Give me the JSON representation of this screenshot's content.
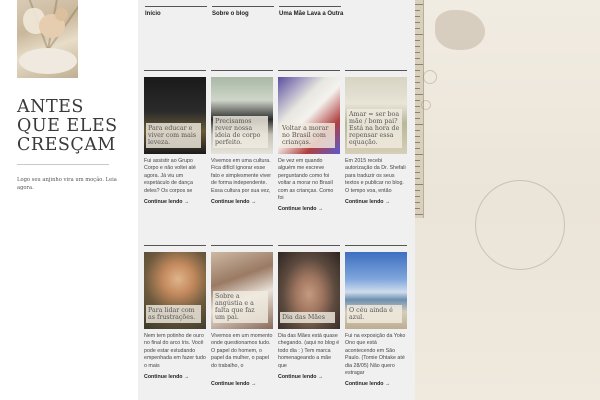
{
  "site": {
    "title": "ANTES QUE ELES CRESÇAM",
    "description": "Logo seu anjinho vira um moção. Leia agora."
  },
  "nav": {
    "items": [
      "Início",
      "Sobre o blog",
      "Uma Mãe Lava a Outra"
    ]
  },
  "posts": [
    {
      "caption": "Para educar e viver com mais leveza.",
      "excerpt": "Fui assistir ao Grupo Corpo e não voltei até agora. Já viu um espetáculo de dança deles? Os corpos se",
      "more": "Continue lendo →"
    },
    {
      "caption": "Precisamos rever nossa ideia de corpo perfeito.",
      "excerpt": "Vivemos em uma cultura. Fica difícil ignorar esse fato e simplesmente viver de forma independente. Essa cultura por sua vez,",
      "more": "Continue lendo →"
    },
    {
      "caption": "Voltar a morar no Brasil com crianças.",
      "excerpt": "De vez em quando alguém me escreve perguntando como foi voltar a morar no Brasil com as crianças. Como foi",
      "more": "Continue lendo →"
    },
    {
      "caption": "Amar = ser boa mãe / bom pai? Está na hora de repensar essa equação.",
      "excerpt": "Em 2015 recebi autorização da Dr. Shefali para traduzir os seus textos e publicar no blog. O tempo voa, então",
      "more": "Continue lendo →"
    },
    {
      "caption": "Para lidar com as frustrações.",
      "excerpt": "Nem tem potinho de ouro no final do arco íris. Você pode estar estudando empenhada em fazer tudo o mais",
      "more": "Continue lendo →"
    },
    {
      "caption": "Sobre a angústia e a falta que faz um pai.",
      "excerpt": "Vivemos em um momento onde questionamos tudo. O papel do homem, o papel da mulher, o papel do trabalho, o",
      "more": "Continue lendo →"
    },
    {
      "caption": "Dia das Mães",
      "excerpt": "Dia das Mães está quase chegando. (aqui no blog é todo dia : ) Tem marca homenageando a mãe que",
      "more": "Continue lendo →"
    },
    {
      "caption": "O céu ainda é azul.",
      "excerpt": "Fui na exposição da Yoko Ono que está acontecendo em São Paulo. (Tomie Ohtake até dia 28/05) Não quero estragar",
      "more": "Continue lendo →"
    }
  ],
  "colors": {
    "main_bg": "#f0f0f0",
    "deco_bg": "#ede6da"
  }
}
